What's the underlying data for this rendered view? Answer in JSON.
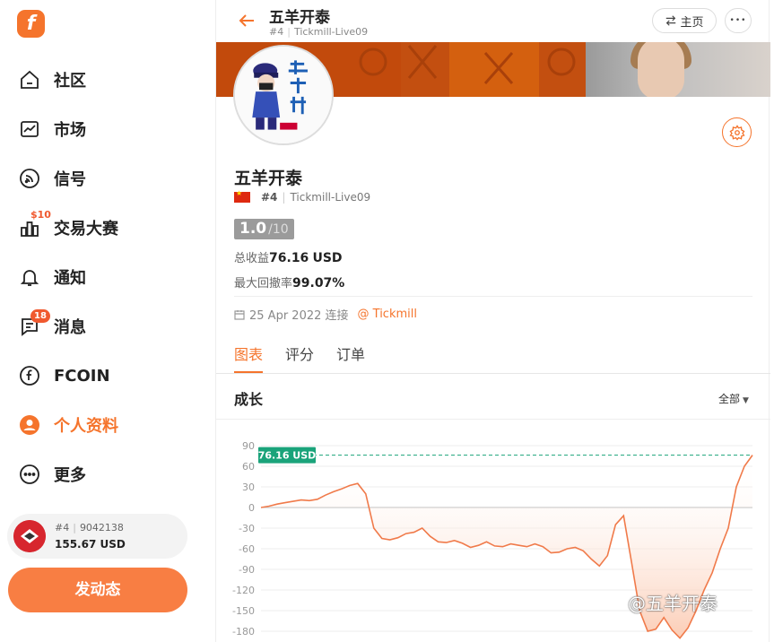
{
  "sidebar": {
    "logo_letter": "f",
    "items": [
      {
        "label": "社区",
        "icon": "home-icon"
      },
      {
        "label": "市场",
        "icon": "market-chart-icon"
      },
      {
        "label": "信号",
        "icon": "signal-rss-icon"
      },
      {
        "label": "交易大赛",
        "icon": "contest-bars-icon",
        "badge": "$10"
      },
      {
        "label": "通知",
        "icon": "bell-icon"
      },
      {
        "label": "消息",
        "icon": "message-icon",
        "badge": "18"
      },
      {
        "label": "FCOIN",
        "icon": "fcoin-icon"
      },
      {
        "label": "个人资料",
        "icon": "profile-icon",
        "active": true
      },
      {
        "label": "更多",
        "icon": "more-circle-icon"
      }
    ],
    "account": {
      "rank": "#4",
      "id": "9042138",
      "balance": "155.67 USD"
    },
    "post_button": "发动态"
  },
  "topbar": {
    "title": "五羊开泰",
    "rank": "#4",
    "account": "Tickmill-Live09",
    "home_label": "主页",
    "more_label": "•••"
  },
  "profile": {
    "name": "五羊开泰",
    "rank": "#4",
    "account": "Tickmill-Live09",
    "score_value": "1.0",
    "score_max": "/10",
    "total_profit_label": "总收益",
    "total_profit_value": "76.16",
    "total_profit_unit": "USD",
    "drawdown_label": "最大回撤率",
    "drawdown_value": "99.07%",
    "joined": "25 Apr 2022 连接",
    "broker": "@ Tickmill"
  },
  "tabs": [
    "图表",
    "评分",
    "订单"
  ],
  "section": {
    "title": "成长",
    "filter": "全部",
    "caret": "▼"
  },
  "watermark": "@五羊开泰",
  "colors": {
    "accent": "#f5742c",
    "badge": "#f0592f",
    "value_tag": "#1aa37a"
  },
  "chart_data": {
    "type": "area",
    "title": "",
    "xlabel": "",
    "ylabel": "",
    "yticks": [
      90,
      60,
      30,
      0,
      -30,
      -60,
      -90,
      -120,
      -150,
      -180
    ],
    "ylim": [
      -190,
      95
    ],
    "grid": true,
    "reference_line": {
      "value": 76.16,
      "label": "76.16 USD"
    },
    "series": [
      {
        "values": [
          0,
          2,
          5,
          7,
          9,
          11,
          10,
          12,
          18,
          23,
          27,
          32,
          35,
          20,
          -30,
          -45,
          -47,
          -44,
          -38,
          -36,
          -30,
          -42,
          -50,
          -51,
          -48,
          -52,
          -58,
          -55,
          -50,
          -56,
          -57,
          -53,
          -55,
          -57,
          -53,
          -57,
          -66,
          -65,
          -60,
          -58,
          -63,
          -75,
          -85,
          -70,
          -25,
          -12,
          -80,
          -150,
          -180,
          -177,
          -160,
          -178,
          -190,
          -175,
          -150,
          -120,
          -95,
          -60,
          -30,
          30,
          60,
          76.16
        ]
      }
    ]
  }
}
